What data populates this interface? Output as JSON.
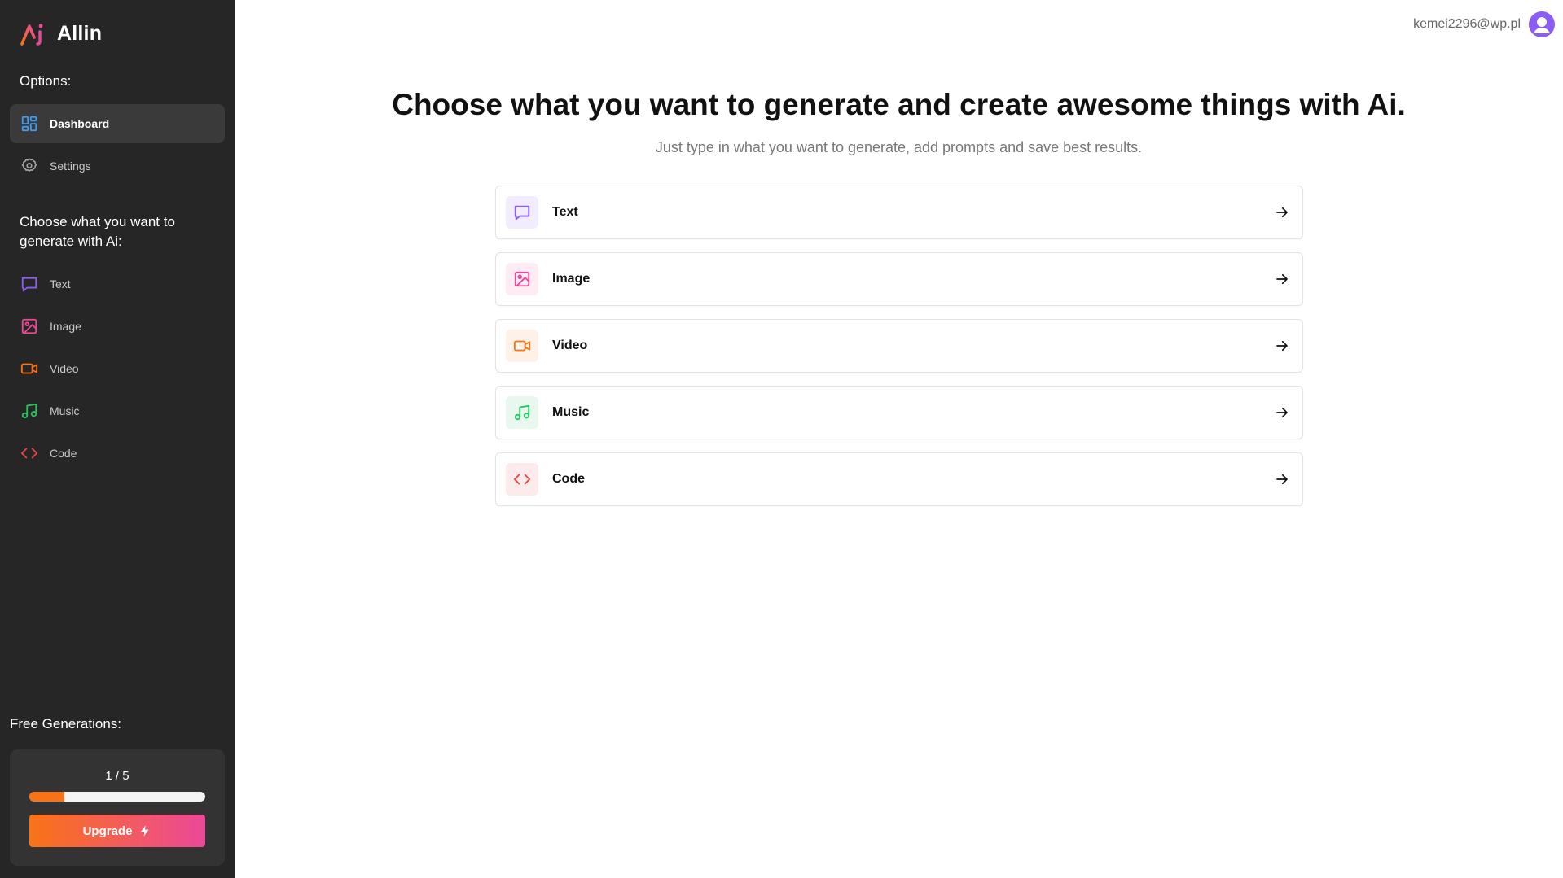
{
  "brand": {
    "name": "Allin"
  },
  "sidebar": {
    "options_label": "Options:",
    "options": [
      {
        "label": "Dashboard",
        "icon": "dashboard-icon",
        "active": true
      },
      {
        "label": "Settings",
        "icon": "gear-icon",
        "active": false
      }
    ],
    "generate_label": "Choose what you want to generate with Ai:",
    "generate_items": [
      {
        "label": "Text",
        "icon": "chat-icon",
        "color": "#8b5cf6"
      },
      {
        "label": "Image",
        "icon": "image-icon",
        "color": "#ec4899"
      },
      {
        "label": "Video",
        "icon": "video-icon",
        "color": "#f97316"
      },
      {
        "label": "Music",
        "icon": "music-icon",
        "color": "#22c55e"
      },
      {
        "label": "Code",
        "icon": "code-icon",
        "color": "#ef4444"
      }
    ],
    "free": {
      "label": "Free Generations:",
      "count_text": "1 / 5",
      "used": 1,
      "total": 5,
      "upgrade_label": "Upgrade"
    }
  },
  "header": {
    "user_email": "kemei2296@wp.pl"
  },
  "main": {
    "title": "Choose what you want to generate and create awesome things with Ai.",
    "subtitle": "Just type in what you want to generate, add prompts and save best results.",
    "cards": [
      {
        "label": "Text",
        "icon": "chat-icon",
        "color": "#8b5cf6",
        "bg": "#f1ecfe"
      },
      {
        "label": "Image",
        "icon": "image-icon",
        "color": "#ec4899",
        "bg": "#fdecf4"
      },
      {
        "label": "Video",
        "icon": "video-icon",
        "color": "#f97316",
        "bg": "#fef1e7"
      },
      {
        "label": "Music",
        "icon": "music-icon",
        "color": "#22c55e",
        "bg": "#e8f8ee"
      },
      {
        "label": "Code",
        "icon": "code-icon",
        "color": "#ef4444",
        "bg": "#fdeaea"
      }
    ]
  },
  "colors": {
    "sidebar_bg": "#262626",
    "accent_orange": "#f97316",
    "accent_pink": "#ec4899",
    "avatar": "#8b5cf6"
  }
}
